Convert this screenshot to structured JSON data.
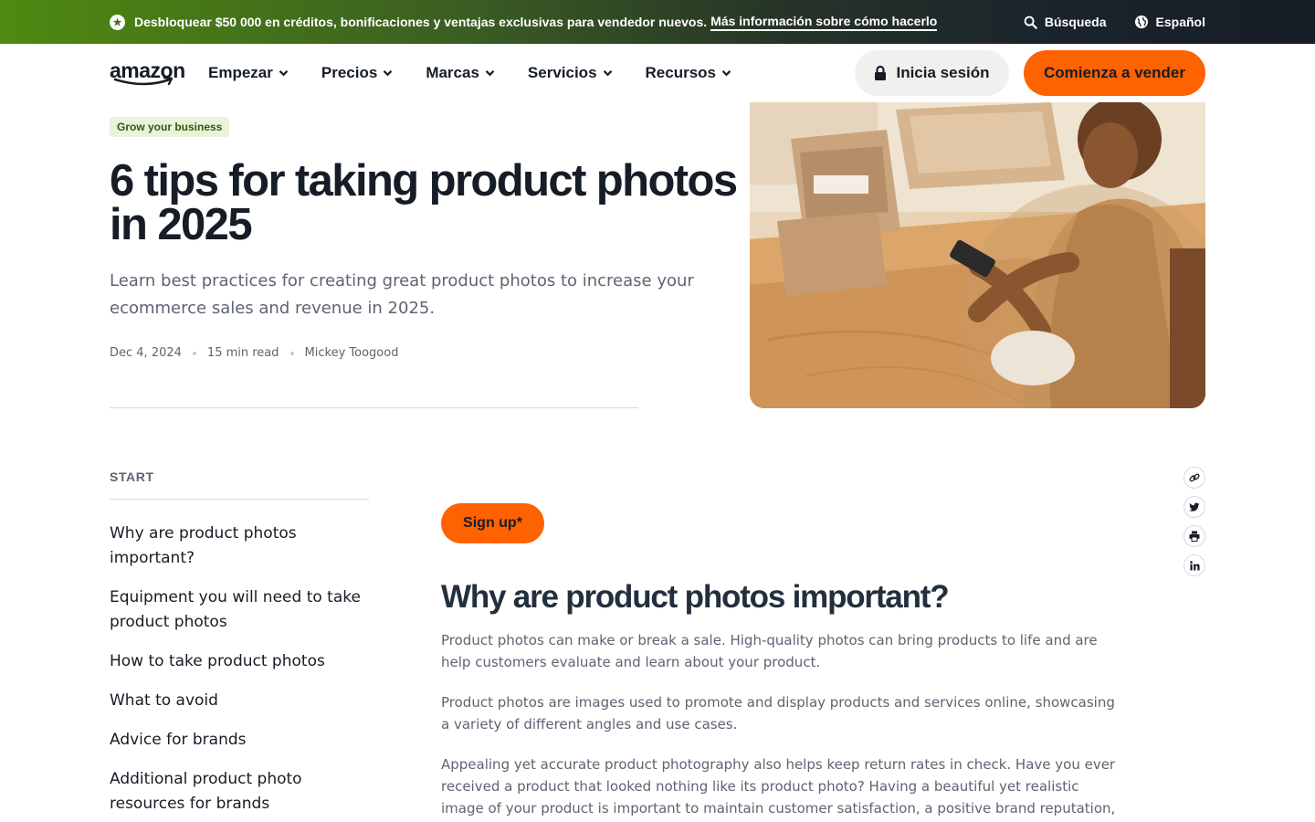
{
  "promo": {
    "text": "Desbloquear $50 000 en créditos, bonificaciones y ventajas exclusivas para vendedor nuevos.",
    "link": "Más información sobre cómo hacerlo",
    "search_label": "Búsqueda",
    "language_label": "Español"
  },
  "nav": {
    "logo_text": "amazon",
    "menu": [
      {
        "label": "Empezar"
      },
      {
        "label": "Precios"
      },
      {
        "label": "Marcas"
      },
      {
        "label": "Servicios"
      },
      {
        "label": "Recursos"
      }
    ],
    "signin_label": "Inicia sesión",
    "sell_label": "Comienza a vender"
  },
  "hero": {
    "tag": "Grow your business",
    "title": "6 tips for taking product photos in 2025",
    "subtitle": "Learn best practices for creating great product photos to increase your ecommerce sales and revenue in 2025.",
    "date": "Dec 4, 2024",
    "read_time": "15 min read",
    "author": "Mickey Toogood"
  },
  "toc": {
    "heading": "START",
    "items": [
      {
        "label": "Why are product photos important?"
      },
      {
        "label": "Equipment you will need to take product photos"
      },
      {
        "label": "How to take product photos"
      },
      {
        "label": "What to avoid"
      },
      {
        "label": "Advice for brands"
      },
      {
        "label": "Additional product photo resources for brands"
      }
    ]
  },
  "article": {
    "signup_label": "Sign up*",
    "heading": "Why are product photos important?",
    "paragraphs": [
      "Product photos can make or break a sale. High-quality photos can bring products to life and are help customers evaluate and learn about your product.",
      "Product photos are images used to promote and display products and services online, showcasing a variety of different angles and use cases.",
      "Appealing yet accurate product photography also helps keep return rates in check. Have you ever received a product that looked nothing like its product photo? Having a beautiful yet realistic image of your product is important to maintain customer satisfaction, a positive brand reputation, and"
    ]
  },
  "share": {
    "icons": [
      "link-icon",
      "twitter-icon",
      "print-icon",
      "linkedin-icon"
    ]
  },
  "colors": {
    "brand_orange": "#ff6200",
    "ink": "#161d26",
    "muted": "#5d6472",
    "tag_bg": "#e9f3da"
  }
}
